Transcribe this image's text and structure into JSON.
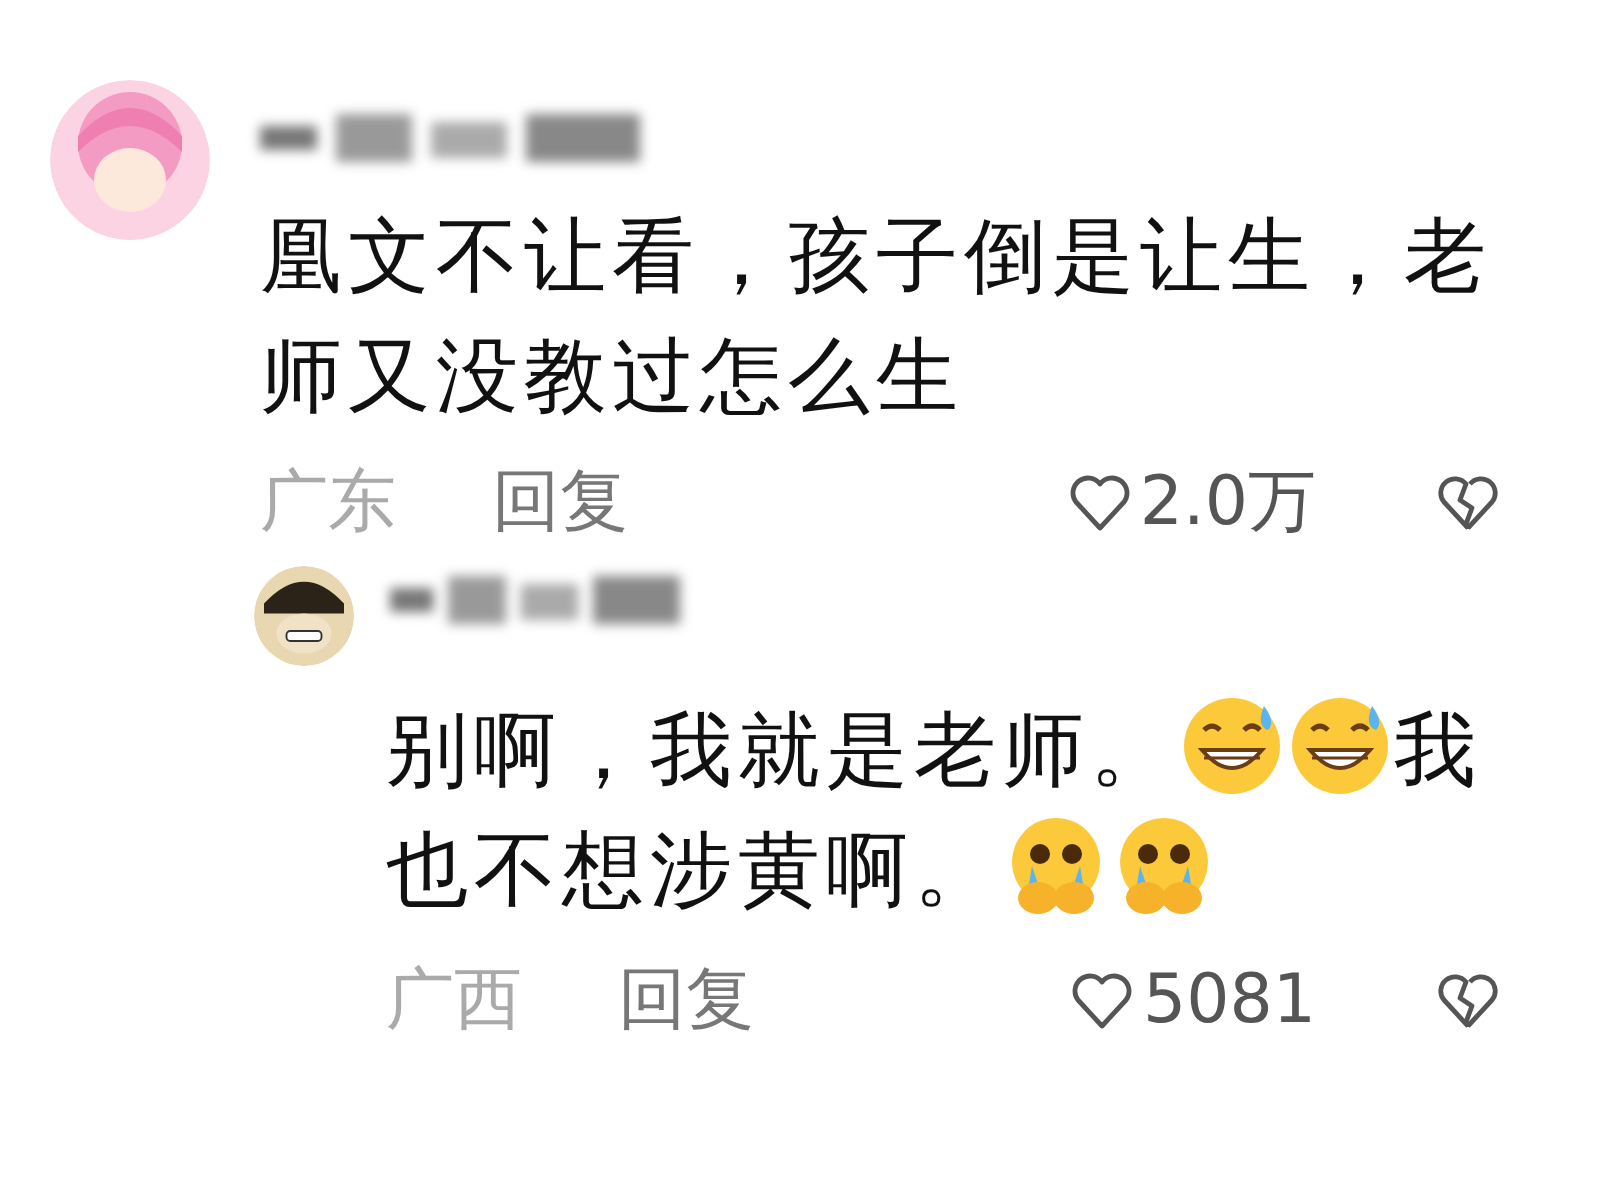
{
  "comments": [
    {
      "content": [
        {
          "kind": "text",
          "text": "凰文不让看，孩子倒是让生，老师又没教过怎么生"
        }
      ],
      "region": "广东",
      "reply": "回复",
      "likes": "2.0万",
      "children": [
        {
          "content": [
            {
              "kind": "text",
              "text": "别啊，我就是老师。"
            },
            {
              "kind": "sweat"
            },
            {
              "kind": "sweat"
            },
            {
              "kind": "text",
              "text": "我也不想涉黄啊。"
            },
            {
              "kind": "cry"
            },
            {
              "kind": "cry"
            }
          ],
          "region": "广西",
          "reply": "回复",
          "likes": "5081"
        }
      ]
    }
  ]
}
